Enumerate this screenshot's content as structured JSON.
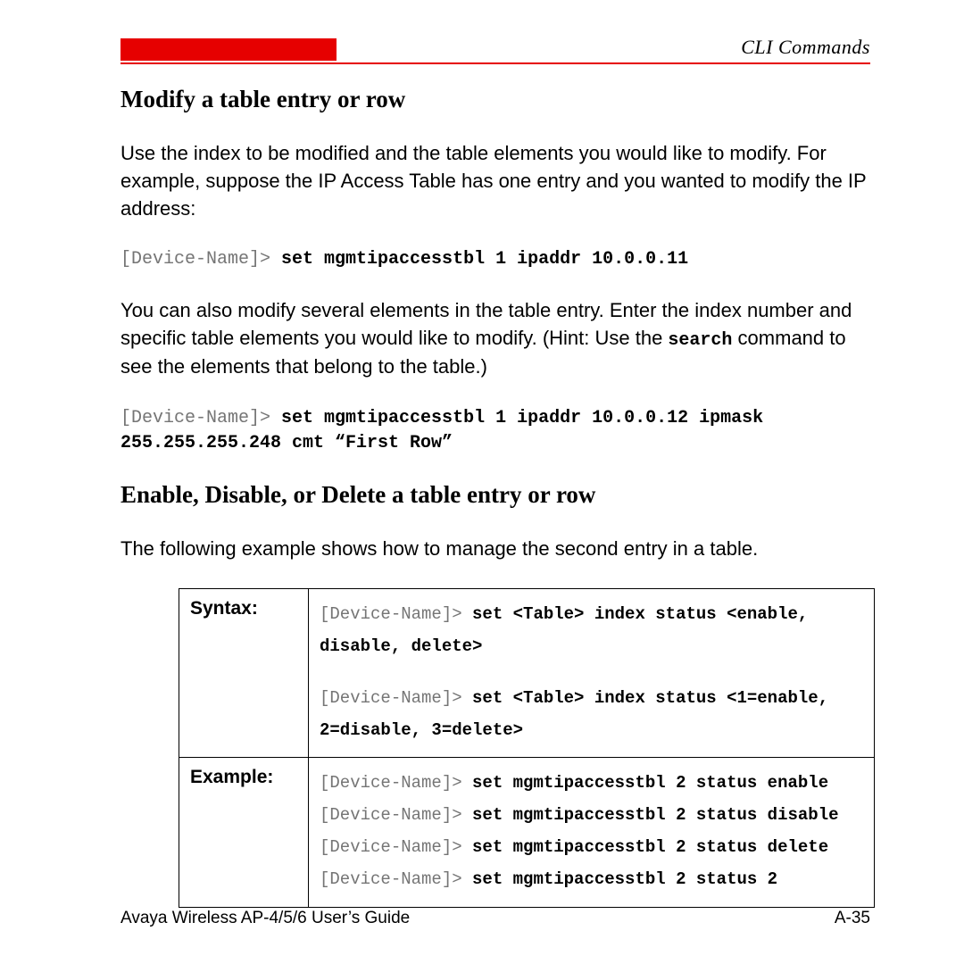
{
  "header": {
    "label": "CLI Commands"
  },
  "section1": {
    "title": "Modify a table entry or row",
    "para1": "Use the index to be modified and the table elements you would like to modify. For example, suppose the IP Access Table has one entry and you wanted to modify the IP address:",
    "cmd1_prompt": "[Device-Name]> ",
    "cmd1_bold": "set mgmtipaccesstbl 1 ipaddr 10.0.0.11",
    "para2_pre": "You can also modify several elements in the table entry. Enter the index number and specific table elements you would like to modify. (Hint: Use the ",
    "para2_mono": "search",
    "para2_post": " command to see the elements that belong to the table.)",
    "cmd2_prompt": "[Device-Name]> ",
    "cmd2_bold_l1": "set mgmtipaccesstbl 1 ipaddr 10.0.0.12 ipmask",
    "cmd2_bold_l2": "255.255.255.248 cmt “First Row”"
  },
  "section2": {
    "title": "Enable, Disable, or Delete a table entry or row",
    "para1": "The following example shows how to manage the second entry in a table.",
    "table": {
      "row1_label": "Syntax:",
      "row1_block1_prompt": "[Device-Name]> ",
      "row1_block1_bold": "set <Table> index status <enable, disable, delete>",
      "row1_block2_prompt": "[Device-Name]> ",
      "row1_block2_bold": "set <Table> index status <1=enable, 2=disable, 3=delete>",
      "row2_label": "Example:",
      "row2_l1_prompt": "[Device-Name]> ",
      "row2_l1_bold": "set mgmtipaccesstbl 2 status enable",
      "row2_l2_prompt": "[Device-Name]> ",
      "row2_l2_bold": "set mgmtipaccesstbl 2 status disable",
      "row2_l3_prompt": "[Device-Name]> ",
      "row2_l3_bold": "set mgmtipaccesstbl 2 status delete",
      "row2_l4_prompt": "[Device-Name]> ",
      "row2_l4_bold": "set mgmtipaccesstbl 2 status 2"
    }
  },
  "footer": {
    "title": "Avaya Wireless AP-4/5/6 User’s Guide",
    "page": "A-35"
  }
}
